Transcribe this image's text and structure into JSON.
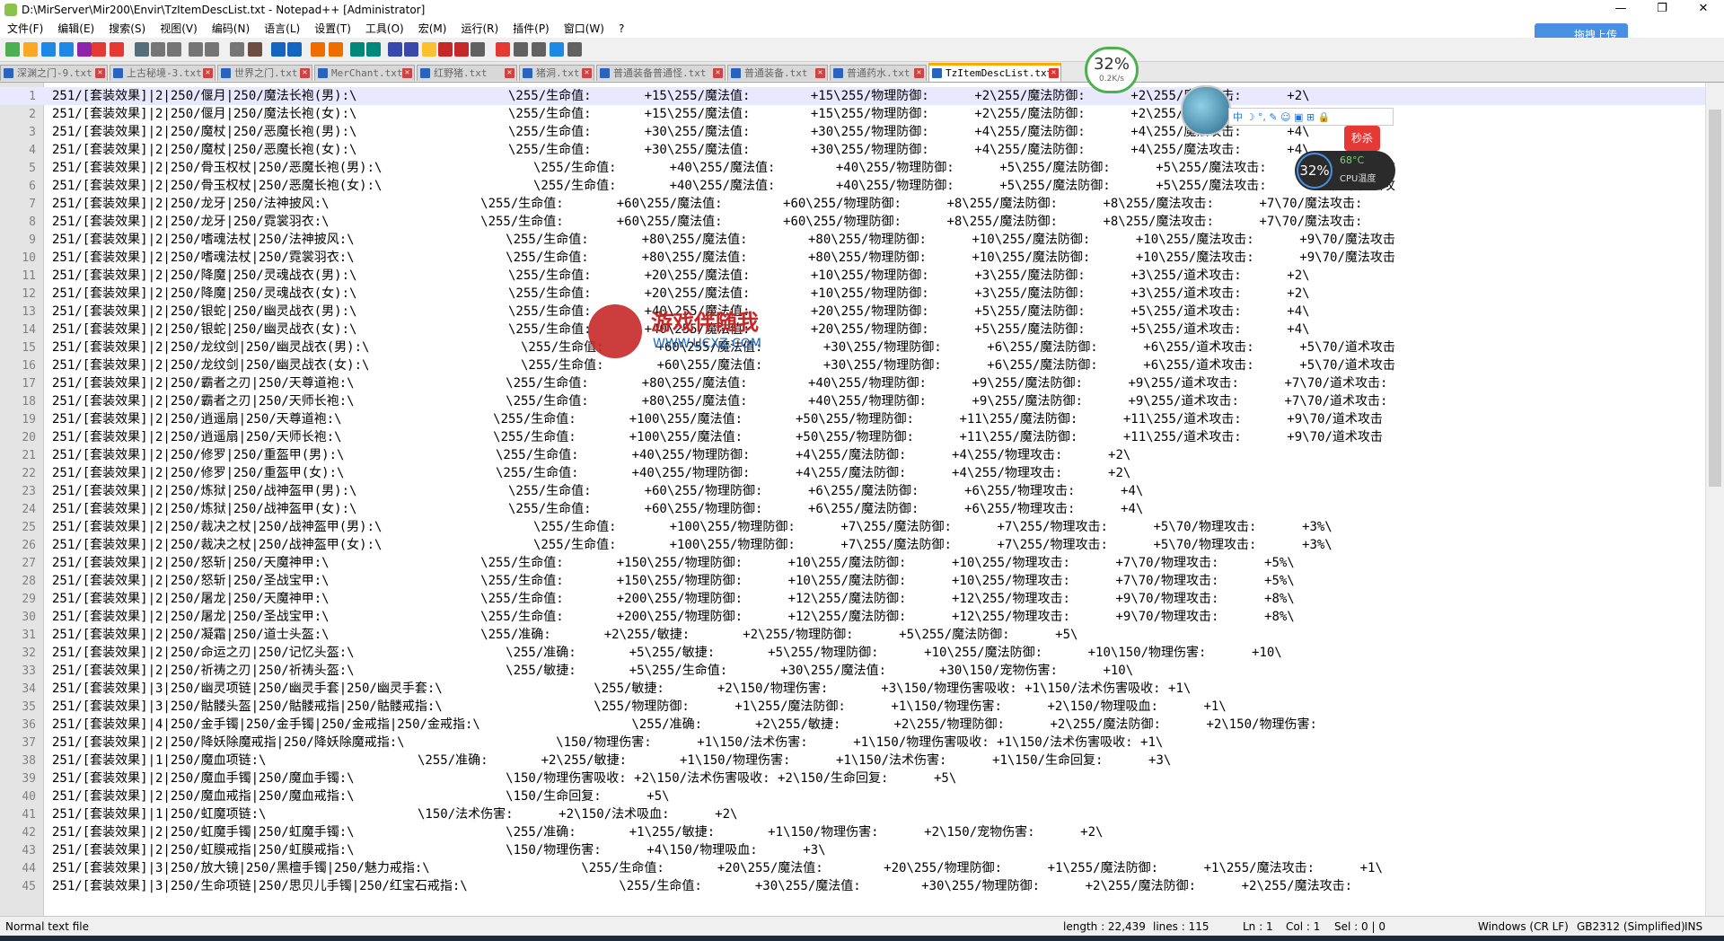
{
  "window": {
    "title": "D:\\MirServer\\Mir200\\Envir\\TzItemDescList.txt - Notepad++ [Administrator]",
    "controls": [
      "—",
      "❐",
      "✕"
    ]
  },
  "menu": [
    "文件(F)",
    "编辑(E)",
    "搜索(S)",
    "视图(V)",
    "编码(N)",
    "语言(L)",
    "设置(T)",
    "工具(O)",
    "宏(M)",
    "运行(R)",
    "插件(P)",
    "窗口(W)",
    "?"
  ],
  "upload_button": "拖拽上传",
  "tabs": [
    {
      "label": "深渊之门-9.txt",
      "active": false
    },
    {
      "label": "上古秘境-3.txt",
      "active": false
    },
    {
      "label": "世界之门.txt",
      "active": false
    },
    {
      "label": "MerChant.txt",
      "active": false
    },
    {
      "label": "红野猪.txt",
      "active": false
    },
    {
      "label": "猪洞.txt",
      "active": false
    },
    {
      "label": "普通装备普通怪.txt",
      "active": false
    },
    {
      "label": "普通装备.txt",
      "active": false
    },
    {
      "label": "普通药水.txt",
      "active": false
    },
    {
      "label": "TzItemDescList.txt",
      "active": true
    }
  ],
  "lines": [
    "251/[套装效果]|2|250/偃月|250/魔法长袍(男):\\                    \\255/生命值:       +15\\255/魔法值:        +15\\255/物理防御:      +2\\255/魔法防御:      +2\\255/魔法攻击:      +2\\",
    "251/[套装效果]|2|250/偃月|250/魔法长袍(女):\\                    \\255/生命值:       +15\\255/魔法值:        +15\\255/物理防御:      +2\\255/魔法防御:      +2\\255/魔法攻击:      +2\\",
    "251/[套装效果]|2|250/魔杖|250/恶魔长袍(男):\\                    \\255/生命值:       +30\\255/魔法值:        +30\\255/物理防御:      +4\\255/魔法防御:      +4\\255/魔法攻击:      +4\\",
    "251/[套装效果]|2|250/魔杖|250/恶魔长袍(女):\\                    \\255/生命值:       +30\\255/魔法值:        +30\\255/物理防御:      +4\\255/魔法防御:      +4\\255/魔法攻击:      +4\\",
    "251/[套装效果]|2|250/骨玉权杖|250/恶魔长袍(男):\\                    \\255/生命值:       +40\\255/魔法值:        +40\\255/物理防御:      +5\\255/魔法防御:      +5\\255/魔法攻击:      +5\\70/魔法攻",
    "251/[套装效果]|2|250/骨玉权杖|250/恶魔长袍(女):\\                    \\255/生命值:       +40\\255/魔法值:        +40\\255/物理防御:      +5\\255/魔法防御:      +5\\255/魔法攻击:      +5\\70/魔法攻",
    "251/[套装效果]|2|250/龙牙|250/法神披风:\\                    \\255/生命值:       +60\\255/魔法值:        +60\\255/物理防御:      +8\\255/魔法防御:      +8\\255/魔法攻击:      +7\\70/魔法攻击:",
    "251/[套装效果]|2|250/龙牙|250/霓裳羽衣:\\                    \\255/生命值:       +60\\255/魔法值:        +60\\255/物理防御:      +8\\255/魔法防御:      +8\\255/魔法攻击:      +7\\70/魔法攻击:",
    "251/[套装效果]|2|250/嗜魂法杖|250/法神披风:\\                    \\255/生命值:       +80\\255/魔法值:        +80\\255/物理防御:      +10\\255/魔法防御:      +10\\255/魔法攻击:      +9\\70/魔法攻击",
    "251/[套装效果]|2|250/嗜魂法杖|250/霓裳羽衣:\\                    \\255/生命值:       +80\\255/魔法值:        +80\\255/物理防御:      +10\\255/魔法防御:      +10\\255/魔法攻击:      +9\\70/魔法攻击",
    "251/[套装效果]|2|250/降魔|250/灵魂战衣(男):\\                    \\255/生命值:       +20\\255/魔法值:        +10\\255/物理防御:      +3\\255/魔法防御:      +3\\255/道术攻击:      +2\\",
    "251/[套装效果]|2|250/降魔|250/灵魂战衣(女):\\                    \\255/生命值:       +20\\255/魔法值:        +10\\255/物理防御:      +3\\255/魔法防御:      +3\\255/道术攻击:      +2\\",
    "251/[套装效果]|2|250/银蛇|250/幽灵战衣(男):\\                    \\255/生命值:       +40\\255/魔法值:        +20\\255/物理防御:      +5\\255/魔法防御:      +5\\255/道术攻击:      +4\\",
    "251/[套装效果]|2|250/银蛇|250/幽灵战衣(女):\\                    \\255/生命值:       +40\\255/魔法值:        +20\\255/物理防御:      +5\\255/魔法防御:      +5\\255/道术攻击:      +4\\",
    "251/[套装效果]|2|250/龙纹剑|250/幽灵战衣(男):\\                    \\255/生命值:       +60\\255/魔法值:        +30\\255/物理防御:      +6\\255/魔法防御:      +6\\255/道术攻击:      +5\\70/道术攻击",
    "251/[套装效果]|2|250/龙纹剑|250/幽灵战衣(女):\\                    \\255/生命值:       +60\\255/魔法值:        +30\\255/物理防御:      +6\\255/魔法防御:      +6\\255/道术攻击:      +5\\70/道术攻击",
    "251/[套装效果]|2|250/霸者之刃|250/天尊道袍:\\                    \\255/生命值:       +80\\255/魔法值:        +40\\255/物理防御:      +9\\255/魔法防御:      +9\\255/道术攻击:      +7\\70/道术攻击:",
    "251/[套装效果]|2|250/霸者之刃|250/天师长袍:\\                    \\255/生命值:       +80\\255/魔法值:        +40\\255/物理防御:      +9\\255/魔法防御:      +9\\255/道术攻击:      +7\\70/道术攻击:",
    "251/[套装效果]|2|250/逍遥扇|250/天尊道袍:\\                    \\255/生命值:       +100\\255/魔法值:       +50\\255/物理防御:      +11\\255/魔法防御:      +11\\255/道术攻击:      +9\\70/道术攻击",
    "251/[套装效果]|2|250/逍遥扇|250/天师长袍:\\                    \\255/生命值:       +100\\255/魔法值:       +50\\255/物理防御:      +11\\255/魔法防御:      +11\\255/道术攻击:      +9\\70/道术攻击",
    "251/[套装效果]|2|250/修罗|250/重盔甲(男):\\                    \\255/生命值:       +40\\255/物理防御:      +4\\255/魔法防御:      +4\\255/物理攻击:      +2\\",
    "251/[套装效果]|2|250/修罗|250/重盔甲(女):\\                    \\255/生命值:       +40\\255/物理防御:      +4\\255/魔法防御:      +4\\255/物理攻击:      +2\\",
    "251/[套装效果]|2|250/炼狱|250/战神盔甲(男):\\                    \\255/生命值:       +60\\255/物理防御:      +6\\255/魔法防御:      +6\\255/物理攻击:      +4\\",
    "251/[套装效果]|2|250/炼狱|250/战神盔甲(女):\\                    \\255/生命值:       +60\\255/物理防御:      +6\\255/魔法防御:      +6\\255/物理攻击:      +4\\",
    "251/[套装效果]|2|250/裁决之杖|250/战神盔甲(男):\\                    \\255/生命值:       +100\\255/物理防御:      +7\\255/魔法防御:      +7\\255/物理攻击:      +5\\70/物理攻击:      +3%\\",
    "251/[套装效果]|2|250/裁决之杖|250/战神盔甲(女):\\                    \\255/生命值:       +100\\255/物理防御:      +7\\255/魔法防御:      +7\\255/物理攻击:      +5\\70/物理攻击:      +3%\\",
    "251/[套装效果]|2|250/怒斩|250/天魔神甲:\\                    \\255/生命值:       +150\\255/物理防御:      +10\\255/魔法防御:      +10\\255/物理攻击:      +7\\70/物理攻击:      +5%\\",
    "251/[套装效果]|2|250/怒斩|250/圣战宝甲:\\                    \\255/生命值:       +150\\255/物理防御:      +10\\255/魔法防御:      +10\\255/物理攻击:      +7\\70/物理攻击:      +5%\\",
    "251/[套装效果]|2|250/屠龙|250/天魔神甲:\\                    \\255/生命值:       +200\\255/物理防御:      +12\\255/魔法防御:      +12\\255/物理攻击:      +9\\70/物理攻击:      +8%\\",
    "251/[套装效果]|2|250/屠龙|250/圣战宝甲:\\                    \\255/生命值:       +200\\255/物理防御:      +12\\255/魔法防御:      +12\\255/物理攻击:      +9\\70/物理攻击:      +8%\\",
    "251/[套装效果]|2|250/凝霜|250/道士头盔:\\                    \\255/准确:       +2\\255/敏捷:       +2\\255/物理防御:      +5\\255/魔法防御:      +5\\",
    "251/[套装效果]|2|250/命运之刃|250/记忆头盔:\\                    \\255/准确:       +5\\255/敏捷:       +5\\255/物理防御:      +10\\255/魔法防御:      +10\\150/物理伤害:      +10\\",
    "251/[套装效果]|2|250/祈祷之刃|250/祈祷头盔:\\                    \\255/敏捷:       +5\\255/生命值:       +30\\255/魔法值:       +30\\150/宠物伤害:      +10\\",
    "251/[套装效果]|3|250/幽灵项链|250/幽灵手套|250/幽灵手套:\\                    \\255/敏捷:       +2\\150/物理伤害:       +3\\150/物理伤害吸收: +1\\150/法术伤害吸收: +1\\",
    "251/[套装效果]|3|250/骷髅头盔|250/骷髅戒指|250/骷髅戒指:\\                    \\255/物理防御:      +1\\255/魔法防御:      +1\\150/物理伤害:      +2\\150/物理吸血:      +1\\",
    "251/[套装效果]|4|250/金手镯|250/金手镯|250/金戒指|250/金戒指:\\                    \\255/准确:       +2\\255/敏捷:       +2\\255/物理防御:      +2\\255/魔法防御:      +2\\150/物理伤害:",
    "251/[套装效果]|2|250/降妖除魔戒指|250/降妖除魔戒指:\\                    \\150/物理伤害:      +1\\150/法术伤害:      +1\\150/物理伤害吸收: +1\\150/法术伤害吸收: +1\\",
    "251/[套装效果]|1|250/魔血项链:\\                    \\255/准确:       +2\\255/敏捷:       +1\\150/物理伤害:      +1\\150/法术伤害:      +1\\150/生命回复:      +3\\",
    "251/[套装效果]|2|250/魔血手镯|250/魔血手镯:\\                    \\150/物理伤害吸收: +2\\150/法术伤害吸收: +2\\150/生命回复:      +5\\",
    "251/[套装效果]|2|250/魔血戒指|250/魔血戒指:\\                    \\150/生命回复:      +5\\",
    "251/[套装效果]|1|250/虹魔项链:\\                    \\150/法术伤害:      +2\\150/法术吸血:      +2\\",
    "251/[套装效果]|2|250/虹魔手镯|250/虹魔手镯:\\                    \\255/准确:       +1\\255/敏捷:       +1\\150/物理伤害:      +2\\150/宠物伤害:      +2\\",
    "251/[套装效果]|2|250/虹膜戒指|250/虹膜戒指:\\                    \\150/物理伤害:      +4\\150/物理吸血:      +3\\",
    "251/[套装效果]|3|250/放大镜|250/黑檀手镯|250/魅力戒指:\\                    \\255/生命值:       +20\\255/魔法值:        +20\\255/物理防御:      +1\\255/魔法防御:      +1\\255/魔法攻击:      +1\\",
    "251/[套装效果]|3|250/生命项链|250/思贝儿手镯|250/红宝石戒指:\\                    \\255/生命值:       +30\\255/魔法值:        +30\\255/物理防御:      +2\\255/魔法防御:      +2\\255/魔法攻击:"
  ],
  "widgets": {
    "net_percent": "32%",
    "net_speed": "0.2K/s",
    "ime": "中 ☽ °, ✎ ☺ ▣ ⊞ 🔒",
    "sale_badge": "秒杀",
    "cpu_percent": "32%",
    "cpu_temp": "68°C",
    "cpu_label": "CPU温度"
  },
  "watermark": {
    "name": "游戏伴随我",
    "url": "WWW.UCXZ.COM"
  },
  "status": {
    "file_type": "Normal text file",
    "length": "length : 22,439",
    "lines": "lines : 115",
    "ln": "Ln : 1",
    "col": "Col : 1",
    "sel": "Sel : 0 | 0",
    "eol": "Windows (CR LF)",
    "encoding": "GB2312 (Simplified)",
    "mode": "INS"
  }
}
